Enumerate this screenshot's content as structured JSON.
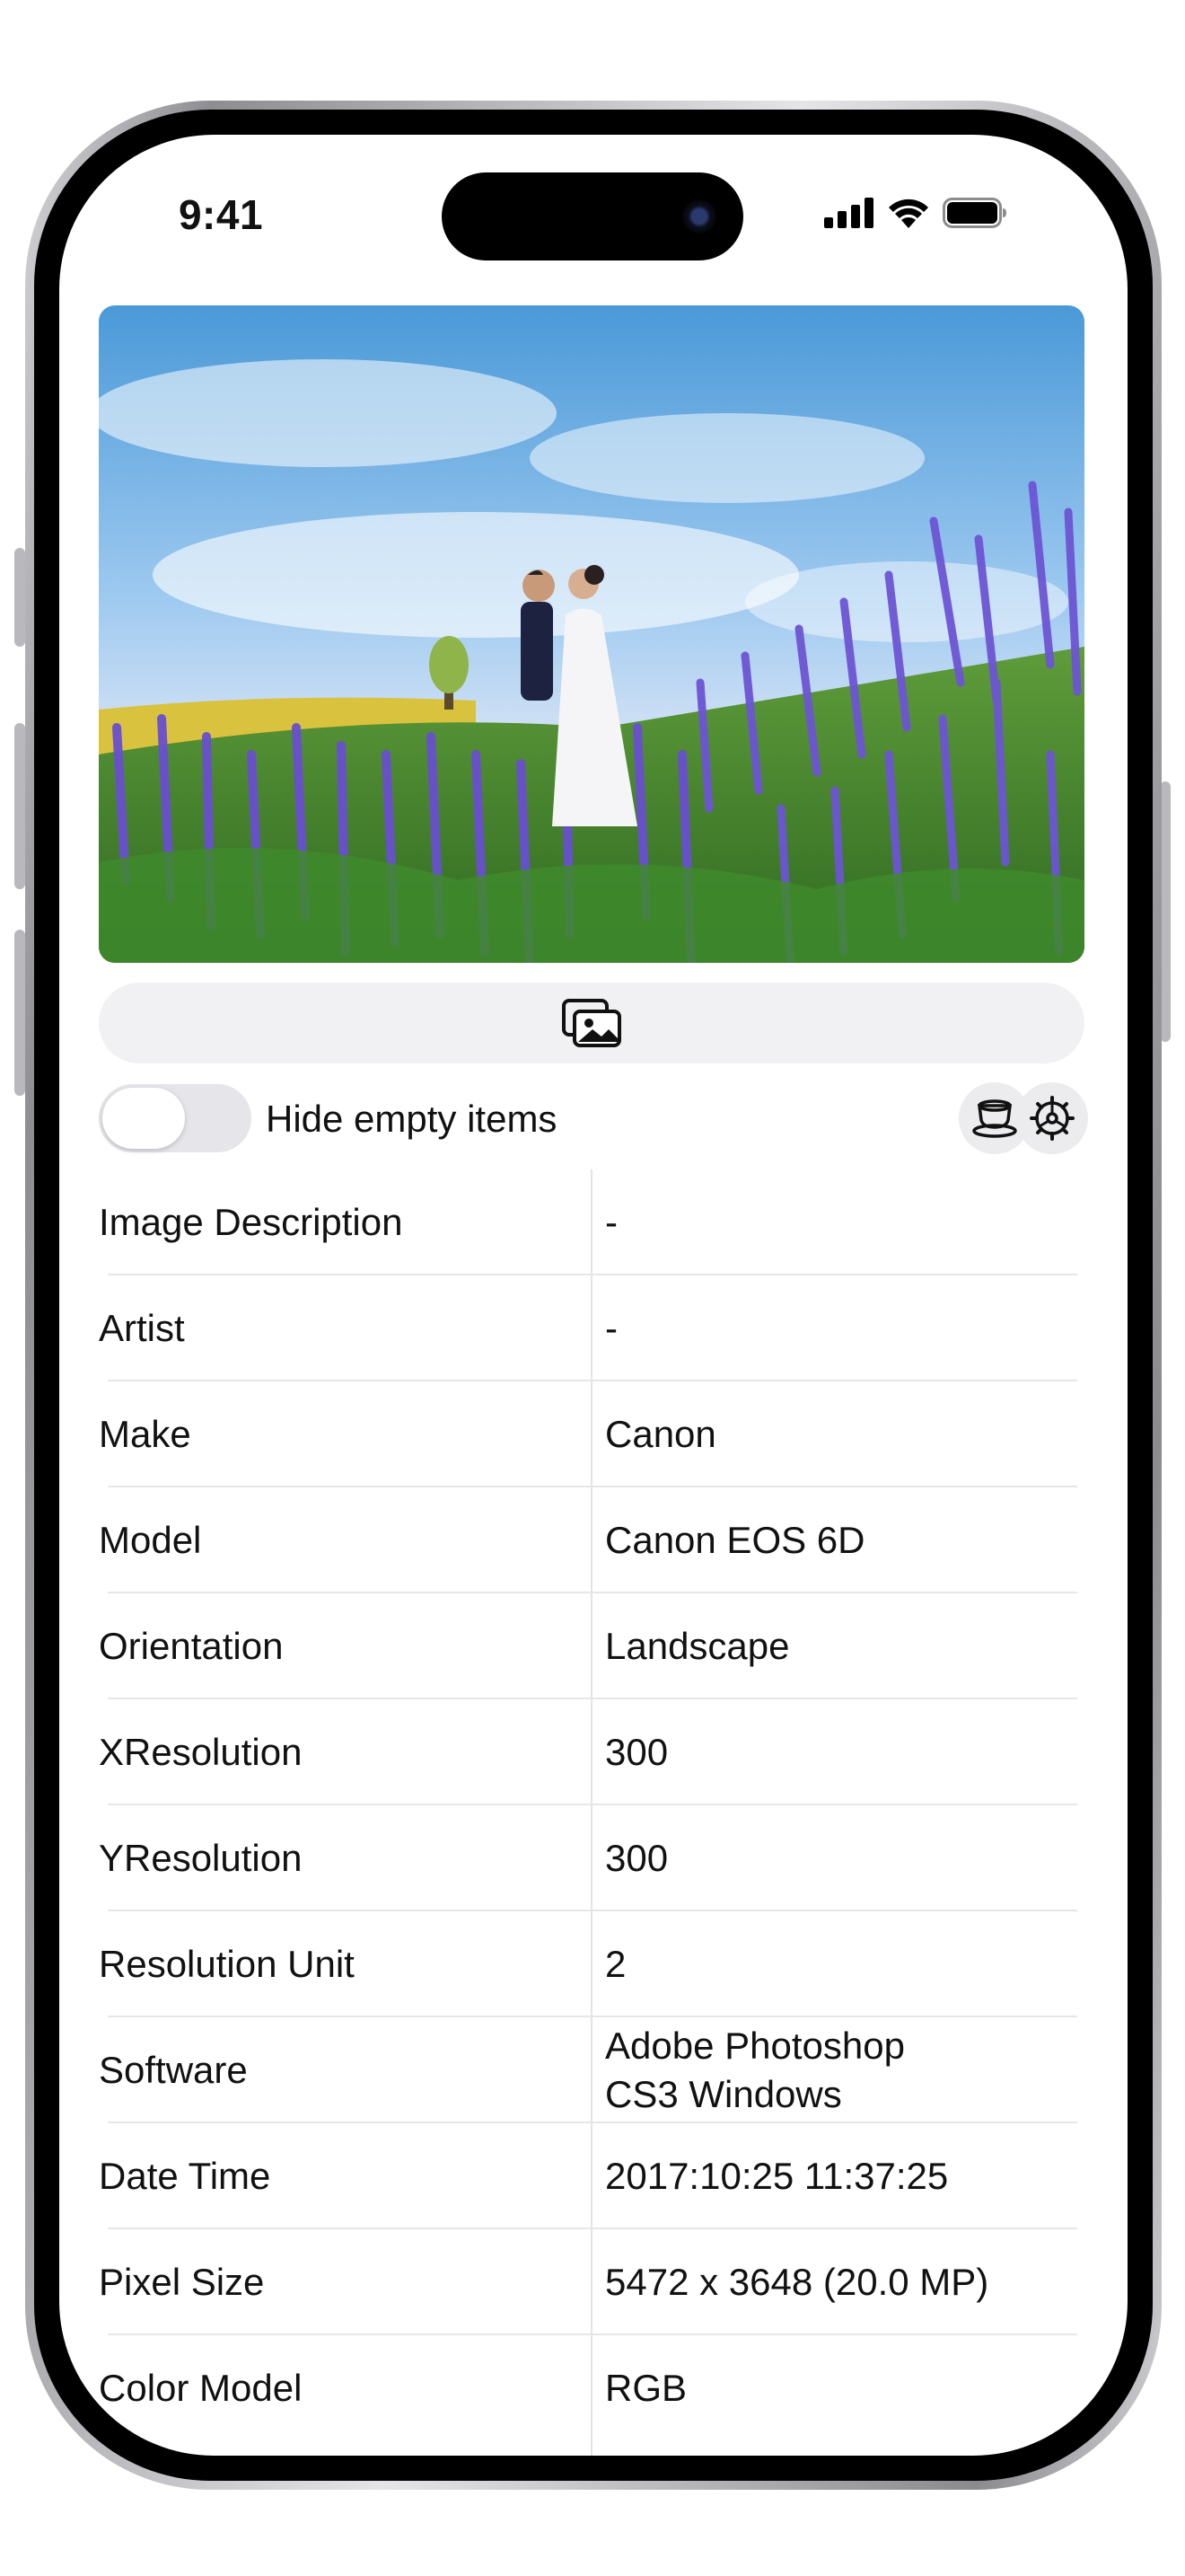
{
  "status_bar": {
    "time": "9:41"
  },
  "photo": {
    "icon": "photo-stack-icon"
  },
  "controls": {
    "hide_empty_label": "Hide empty items",
    "hide_empty_on": false,
    "left_button_icon": "coffee-cup-icon",
    "right_button_icon": "gear-icon"
  },
  "exif": [
    {
      "key": "Image Description",
      "value": "-"
    },
    {
      "key": "Artist",
      "value": "-"
    },
    {
      "key": "Make",
      "value": "Canon"
    },
    {
      "key": "Model",
      "value": "Canon EOS 6D"
    },
    {
      "key": "Orientation",
      "value": "Landscape"
    },
    {
      "key": "XResolution",
      "value": "300"
    },
    {
      "key": "YResolution",
      "value": "300"
    },
    {
      "key": "Resolution Unit",
      "value": "2"
    },
    {
      "key": "Software",
      "value": "Adobe Photoshop\nCS3 Windows"
    },
    {
      "key": "Date Time",
      "value": "2017:10:25 11:37:25"
    },
    {
      "key": "Pixel Size",
      "value": "5472 x 3648 (20.0 MP)"
    },
    {
      "key": "Color Model",
      "value": "RGB"
    }
  ],
  "colors": {
    "frame": "#000000",
    "toggle_off": "#e5e5ea",
    "bar_bg": "#f1f1f4",
    "sky": "#5aa6e0",
    "flowers": "#6a4fd0"
  }
}
